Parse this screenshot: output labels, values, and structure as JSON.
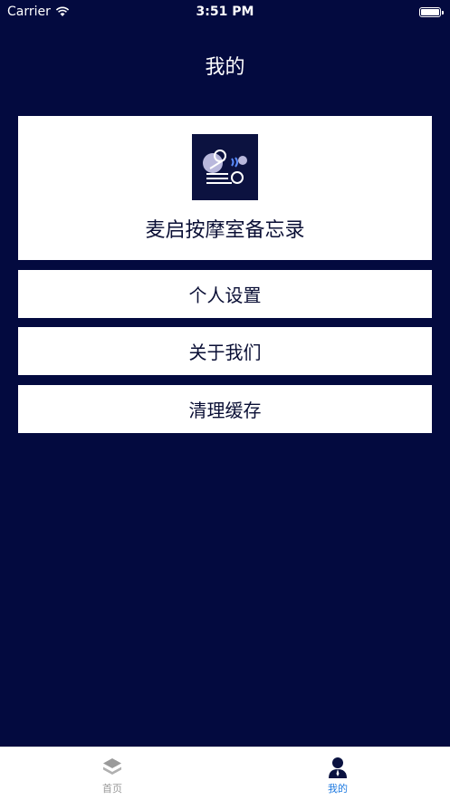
{
  "status_bar": {
    "carrier": "Carrier",
    "time": "3:51 PM"
  },
  "nav": {
    "title": "我的"
  },
  "app_card": {
    "name": "麦启按摩室备忘录"
  },
  "menu": {
    "items": [
      {
        "label": "个人设置"
      },
      {
        "label": "关于我们"
      },
      {
        "label": "清理缓存"
      }
    ]
  },
  "tab_bar": {
    "tabs": [
      {
        "label": "首页",
        "icon": "layers-icon",
        "active": false
      },
      {
        "label": "我的",
        "icon": "person-icon",
        "active": true
      }
    ]
  },
  "colors": {
    "background": "#030a3f",
    "card": "#ffffff",
    "active_tab": "#1f7ae0",
    "inactive_tab": "#9a9a9a"
  }
}
